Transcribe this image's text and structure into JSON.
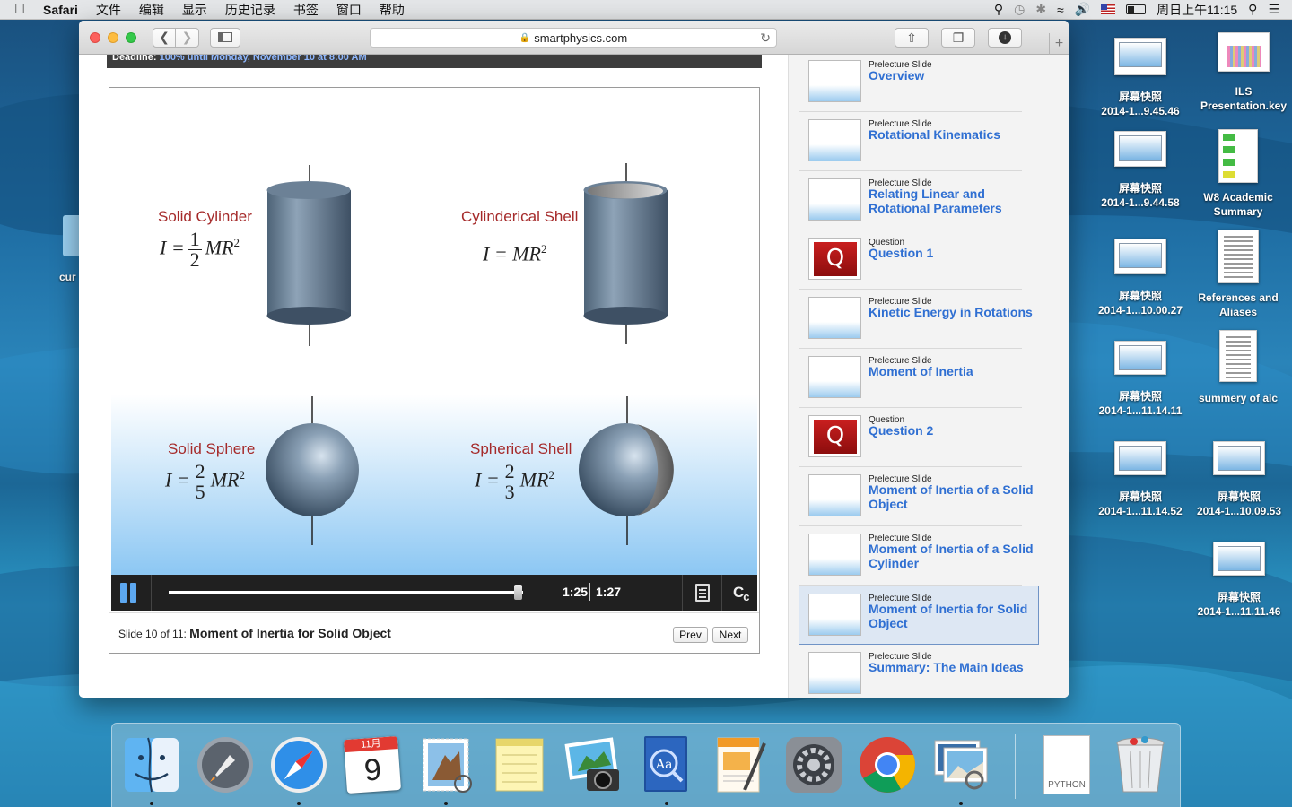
{
  "menubar": {
    "app": "Safari",
    "items": [
      "文件",
      "编辑",
      "显示",
      "历史记录",
      "书签",
      "窗口",
      "帮助"
    ],
    "clock": "周日上午11:15"
  },
  "browser": {
    "url": "smartphysics.com"
  },
  "page": {
    "deadline_label": "Deadline:",
    "deadline_value": "100% until Monday, November 10 at 8:00 AM",
    "slide": {
      "shapes": [
        {
          "label": "Solid Cylinder",
          "formula_lhs": "I =",
          "num": "1",
          "den": "2",
          "rhs": "MR",
          "exp": "2"
        },
        {
          "label": "Cylinderical Shell",
          "formula_lhs": "I = MR",
          "exp": "2"
        },
        {
          "label": "Solid Sphere",
          "formula_lhs": "I =",
          "num": "2",
          "den": "5",
          "rhs": "MR",
          "exp": "2"
        },
        {
          "label": "Spherical Shell",
          "formula_lhs": "I =",
          "num": "2",
          "den": "3",
          "rhs": "MR",
          "exp": "2"
        }
      ]
    },
    "player": {
      "current_time": "1:25",
      "total_time": "1:27",
      "progress": 0.985,
      "cc_label": "C"
    },
    "slidebar": {
      "prefix": "Slide 10 of 11: ",
      "title": "Moment of Inertia for Solid Object",
      "prev_label": "Prev",
      "next_label": "Next"
    },
    "slide_list": [
      {
        "kind": "Prelecture Slide",
        "title": "Overview",
        "type": "slide"
      },
      {
        "kind": "Prelecture Slide",
        "title": "Rotational Kinematics",
        "type": "slide"
      },
      {
        "kind": "Prelecture Slide",
        "title": "Relating Linear and Rotational Parameters",
        "type": "slide"
      },
      {
        "kind": "Question",
        "title": "Question 1",
        "type": "question"
      },
      {
        "kind": "Prelecture Slide",
        "title": "Kinetic Energy in Rotations",
        "type": "slide"
      },
      {
        "kind": "Prelecture Slide",
        "title": "Moment of Inertia",
        "type": "slide"
      },
      {
        "kind": "Question",
        "title": "Question 2",
        "type": "question"
      },
      {
        "kind": "Prelecture Slide",
        "title": "Moment of Inertia of a Solid Object",
        "type": "slide"
      },
      {
        "kind": "Prelecture Slide",
        "title": "Moment of Inertia of a Solid Cylinder",
        "type": "slide"
      },
      {
        "kind": "Prelecture Slide",
        "title": "Moment of Inertia for Solid Object",
        "type": "slide",
        "active": true
      },
      {
        "kind": "Prelecture Slide",
        "title": "Summary: The Main Ideas",
        "type": "slide"
      }
    ]
  },
  "desktop": {
    "partial_label": "cur",
    "icons": [
      {
        "name": "屏幕快照 2014-1...9.45.46",
        "line1": "屏幕快照",
        "line2": "2014-1...9.45.46",
        "kind": "shot"
      },
      {
        "name": "ILS Presentation.key",
        "line1": "ILS",
        "line2": "Presentation.key",
        "kind": "key"
      },
      {
        "name": "屏幕快照 2014-1...9.44.58",
        "line1": "屏幕快照",
        "line2": "2014-1...9.44.58",
        "kind": "shot"
      },
      {
        "name": "W8 Academic Summary",
        "line1": "W8 Academic",
        "line2": "Summary",
        "kind": "w8"
      },
      {
        "name": "屏幕快照 2014-1...10.00.27",
        "line1": "屏幕快照",
        "line2": "2014-1...10.00.27",
        "kind": "shot"
      },
      {
        "name": "References and Aliases",
        "line1": "References and",
        "line2": "Aliases",
        "kind": "doc"
      },
      {
        "name": "屏幕快照 2014-1...11.14.11",
        "line1": "屏幕快照",
        "line2": "2014-1...11.14.11",
        "kind": "shot"
      },
      {
        "name": "summery of alc",
        "line1": "summery of alc",
        "line2": "",
        "kind": "doc"
      },
      {
        "name": "屏幕快照 2014-1...11.14.52",
        "line1": "屏幕快照",
        "line2": "2014-1...11.14.52",
        "kind": "shot"
      },
      {
        "name": "屏幕快照 2014-1...10.09.53",
        "line1": "屏幕快照",
        "line2": "2014-1...10.09.53",
        "kind": "shot"
      },
      {
        "name": "屏幕快照 2014-1...11.11.46",
        "line1": "屏幕快照",
        "line2": "2014-1...11.11.46",
        "kind": "shot"
      }
    ]
  },
  "dock": {
    "calendar_month": "11月",
    "calendar_day": "9",
    "python_label": "PYTHON",
    "apps": [
      "Finder",
      "Launchpad",
      "Safari",
      "Calendar",
      "Mail",
      "Notes",
      "iPhoto",
      "Dictionary",
      "Pages",
      "System Preferences",
      "Chrome",
      "Preview",
      "Python",
      "Trash"
    ]
  },
  "colors": {
    "accent_blue": "#2f6fd2",
    "label_red": "#a52a2a",
    "player_bar": "#202020"
  }
}
